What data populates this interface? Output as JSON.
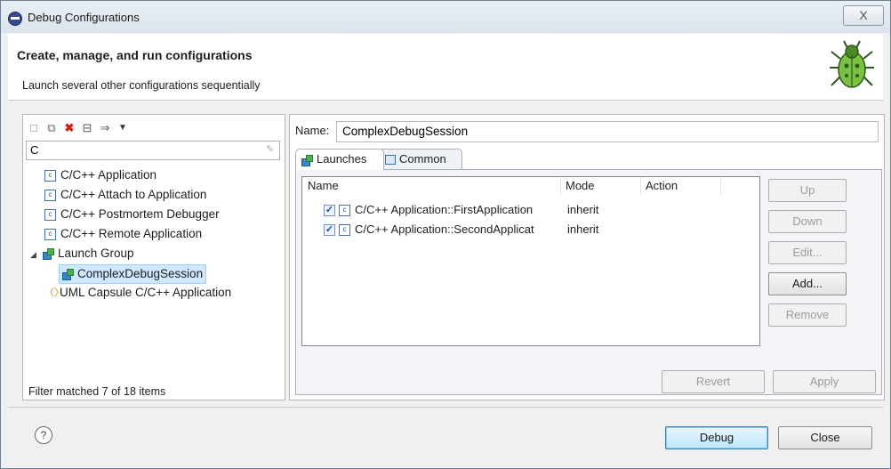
{
  "window": {
    "title": "Debug Configurations",
    "close_label": "X"
  },
  "header": {
    "title": "Create, manage, and run configurations",
    "subtitle": "Launch several other configurations sequentially"
  },
  "left": {
    "filter_value": "C",
    "tree": [
      {
        "label": "C/C++ Application",
        "icon": "c-config-icon"
      },
      {
        "label": "C/C++ Attach to Application",
        "icon": "c-config-icon"
      },
      {
        "label": "C/C++ Postmortem Debugger",
        "icon": "c-config-icon"
      },
      {
        "label": "C/C++ Remote Application",
        "icon": "c-config-icon"
      },
      {
        "label": "Launch Group",
        "icon": "launch-group-icon",
        "expanded": true
      },
      {
        "label": "ComplexDebugSession",
        "icon": "launch-group-icon",
        "selected": true
      },
      {
        "label": "UML Capsule C/C++ Application",
        "icon": "uml-capsule-icon"
      }
    ],
    "status": "Filter matched 7 of 18 items"
  },
  "right": {
    "name_label": "Name:",
    "name_value": "ComplexDebugSession",
    "tabs": [
      {
        "label": "Launches",
        "active": true
      },
      {
        "label": "Common",
        "active": false
      }
    ],
    "launches_table": {
      "columns": [
        "Name",
        "Mode",
        "Action"
      ],
      "rows": [
        {
          "name": "C/C++ Application::FirstApplication",
          "mode": "inherit",
          "action": "",
          "checked": true
        },
        {
          "name": "C/C++ Application::SecondApplicat",
          "mode": "inherit",
          "action": "",
          "checked": true
        }
      ]
    },
    "side_buttons": {
      "up": "Up",
      "down": "Down",
      "edit": "Edit...",
      "add": "Add...",
      "remove": "Remove"
    },
    "revert": "Revert",
    "apply": "Apply"
  },
  "footer": {
    "help": "?",
    "debug": "Debug",
    "close": "Close"
  }
}
